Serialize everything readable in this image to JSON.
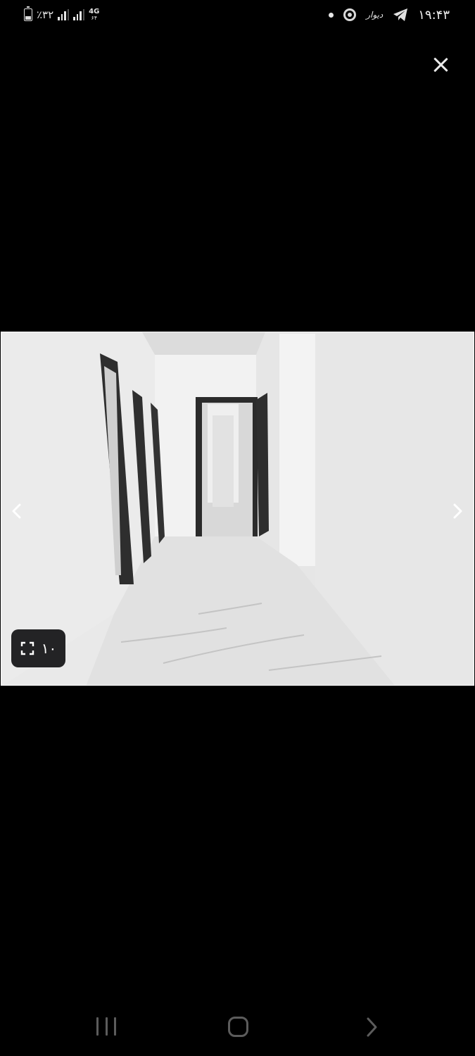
{
  "status_bar": {
    "battery_text": "٪۳۲",
    "network_type": "4G",
    "network_sub": "۶۴",
    "divar_label": "دیوار",
    "time": "۱۹:۴۳"
  },
  "gallery": {
    "image_counter": "۱۰",
    "close_icon": "close-icon",
    "prev_icon": "chevron-left-icon",
    "next_icon": "chevron-right-icon",
    "expand_icon": "fullscreen-icon"
  },
  "colors": {
    "background": "#000000",
    "counter_bg": "#232325",
    "nav_icon": "#5c5c5c"
  }
}
